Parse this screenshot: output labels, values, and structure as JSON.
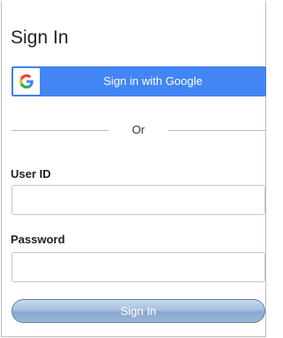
{
  "page": {
    "title": "Sign In"
  },
  "google_button": {
    "label": "Sign in with Google",
    "icon": "google-g-icon",
    "color": "#4285f4"
  },
  "divider": {
    "text": "Or"
  },
  "fields": {
    "user_id": {
      "label": "User ID",
      "value": "",
      "placeholder": ""
    },
    "password": {
      "label": "Password",
      "value": "",
      "placeholder": ""
    }
  },
  "signin_button": {
    "label": "Sign In"
  }
}
